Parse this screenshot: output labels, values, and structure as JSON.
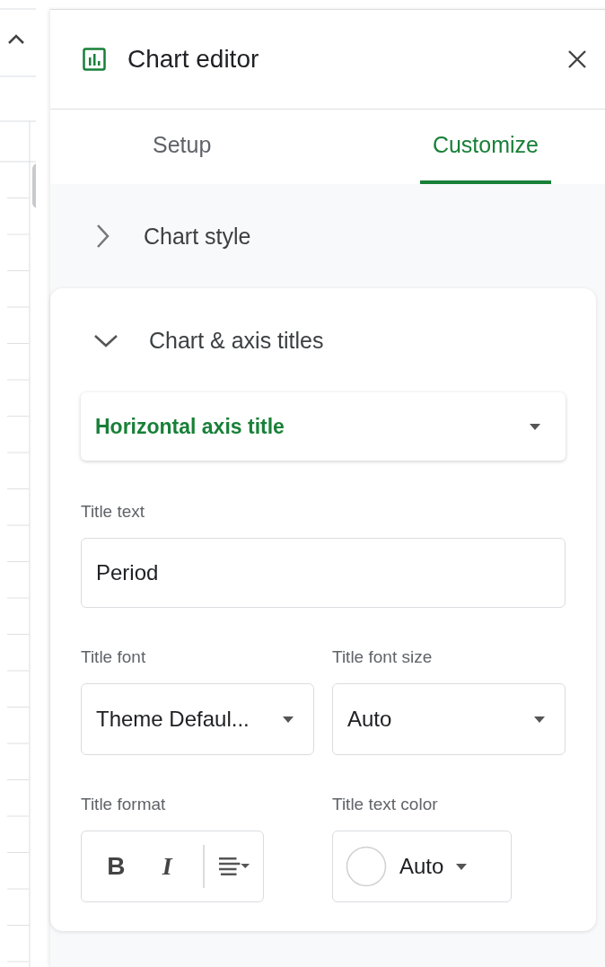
{
  "window": {
    "title": "Chart editor"
  },
  "tabs": [
    {
      "label": "Setup",
      "selected": false
    },
    {
      "label": "Customize",
      "selected": true
    }
  ],
  "sections": [
    {
      "label": "Chart style",
      "expanded": false
    },
    {
      "label": "Chart & axis titles",
      "expanded": true
    }
  ],
  "titles": {
    "dropdown": "Horizontal axis title",
    "title_text": {
      "label": "Title text",
      "value": "Period"
    },
    "title_font": {
      "label": "Title font",
      "value": "Theme Defaul..."
    },
    "title_font_size": {
      "label": "Title font size",
      "value": "Auto"
    },
    "title_format": {
      "label": "Title format",
      "bold": "B",
      "italic": "I"
    },
    "title_text_color": {
      "label": "Title text color",
      "value": "Auto"
    }
  }
}
